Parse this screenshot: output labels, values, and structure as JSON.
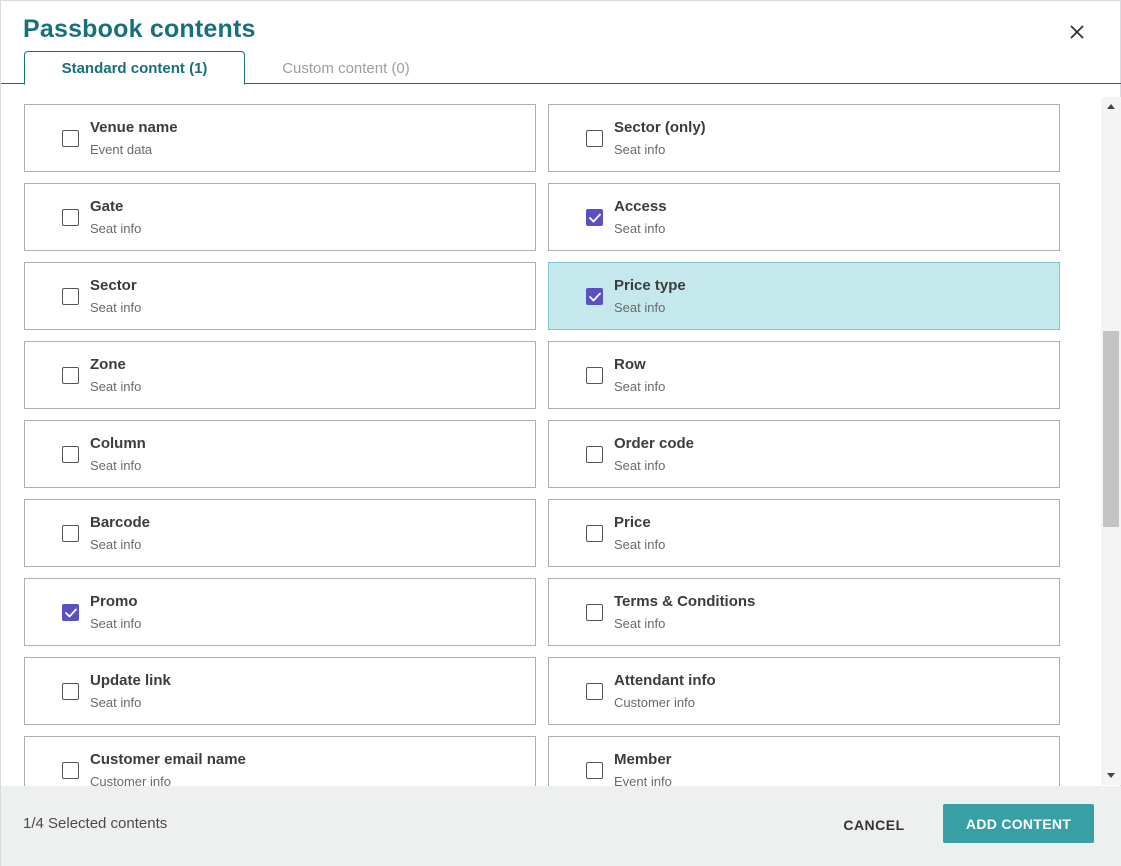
{
  "dialog": {
    "title": "Passbook contents",
    "close_glyph": "×"
  },
  "tabs": [
    {
      "label": "Standard content (1)",
      "active": true
    },
    {
      "label": "Custom content (0)",
      "active": false
    }
  ],
  "items": [
    {
      "title": "Venue name",
      "subtitle": "Event data",
      "checked": false,
      "highlighted": false
    },
    {
      "title": "Sector (only)",
      "subtitle": "Seat info",
      "checked": false,
      "highlighted": false
    },
    {
      "title": "Gate",
      "subtitle": "Seat info",
      "checked": false,
      "highlighted": false
    },
    {
      "title": "Access",
      "subtitle": "Seat info",
      "checked": true,
      "highlighted": false
    },
    {
      "title": "Sector",
      "subtitle": "Seat info",
      "checked": false,
      "highlighted": false
    },
    {
      "title": "Price type",
      "subtitle": "Seat info",
      "checked": true,
      "highlighted": true
    },
    {
      "title": "Zone",
      "subtitle": "Seat info",
      "checked": false,
      "highlighted": false
    },
    {
      "title": "Row",
      "subtitle": "Seat info",
      "checked": false,
      "highlighted": false
    },
    {
      "title": "Column",
      "subtitle": "Seat info",
      "checked": false,
      "highlighted": false
    },
    {
      "title": "Order code",
      "subtitle": "Seat info",
      "checked": false,
      "highlighted": false
    },
    {
      "title": "Barcode",
      "subtitle": "Seat info",
      "checked": false,
      "highlighted": false
    },
    {
      "title": "Price",
      "subtitle": "Seat info",
      "checked": false,
      "highlighted": false
    },
    {
      "title": "Promo",
      "subtitle": "Seat info",
      "checked": true,
      "highlighted": false
    },
    {
      "title": "Terms & Conditions",
      "subtitle": "Seat info",
      "checked": false,
      "highlighted": false
    },
    {
      "title": "Update link",
      "subtitle": "Seat info",
      "checked": false,
      "highlighted": false
    },
    {
      "title": "Attendant info",
      "subtitle": "Customer info",
      "checked": false,
      "highlighted": false
    },
    {
      "title": "Customer email name",
      "subtitle": "Customer info",
      "checked": false,
      "highlighted": false
    },
    {
      "title": "Member",
      "subtitle": "Event info",
      "checked": false,
      "highlighted": false
    }
  ],
  "footer": {
    "selected_count": "1/4 Selected contents",
    "cancel_label": "CANCEL",
    "add_label": "ADD CONTENT"
  },
  "colors": {
    "brand": "#17707a",
    "checkbox_checked": "#5b4fc4",
    "highlight_bg": "#c4e8ec",
    "primary_button": "#37a0a6"
  },
  "icons": {
    "close": "close-icon",
    "checkmark": "checkmark-icon",
    "scroll_up": "arrow-up-icon",
    "scroll_down": "arrow-down-icon"
  }
}
